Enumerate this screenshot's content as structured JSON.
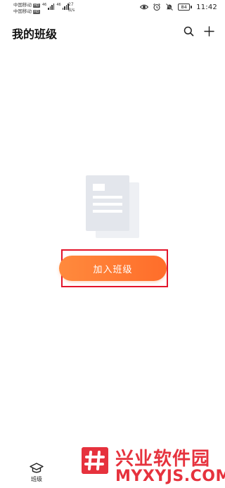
{
  "status_bar": {
    "carrier1": "中国移动",
    "carrier1_badge": "HD",
    "carrier2": "中国移动",
    "carrier2_badge": "HD",
    "network_speed_value": "27",
    "network_speed_unit": "B/s",
    "battery_level": "84",
    "time": "11:42",
    "icons": [
      "eye-icon",
      "alarm-icon",
      "mute-icon"
    ]
  },
  "header": {
    "title": "我的班级",
    "search_icon": "search-icon",
    "add_icon": "plus-icon"
  },
  "empty_state": {
    "illustration": "document-icon"
  },
  "actions": {
    "join_class_label": "加入班级",
    "highlight_color": "#e3142a",
    "button_color": "#ff7a33"
  },
  "bottom_nav": {
    "items": [
      {
        "label": "班级",
        "icon": "graduation-cap-icon",
        "active": true
      }
    ]
  },
  "watermark": {
    "brand": "兴业软件园",
    "url": "MYXYJS.COM",
    "color": "#e6323d"
  }
}
